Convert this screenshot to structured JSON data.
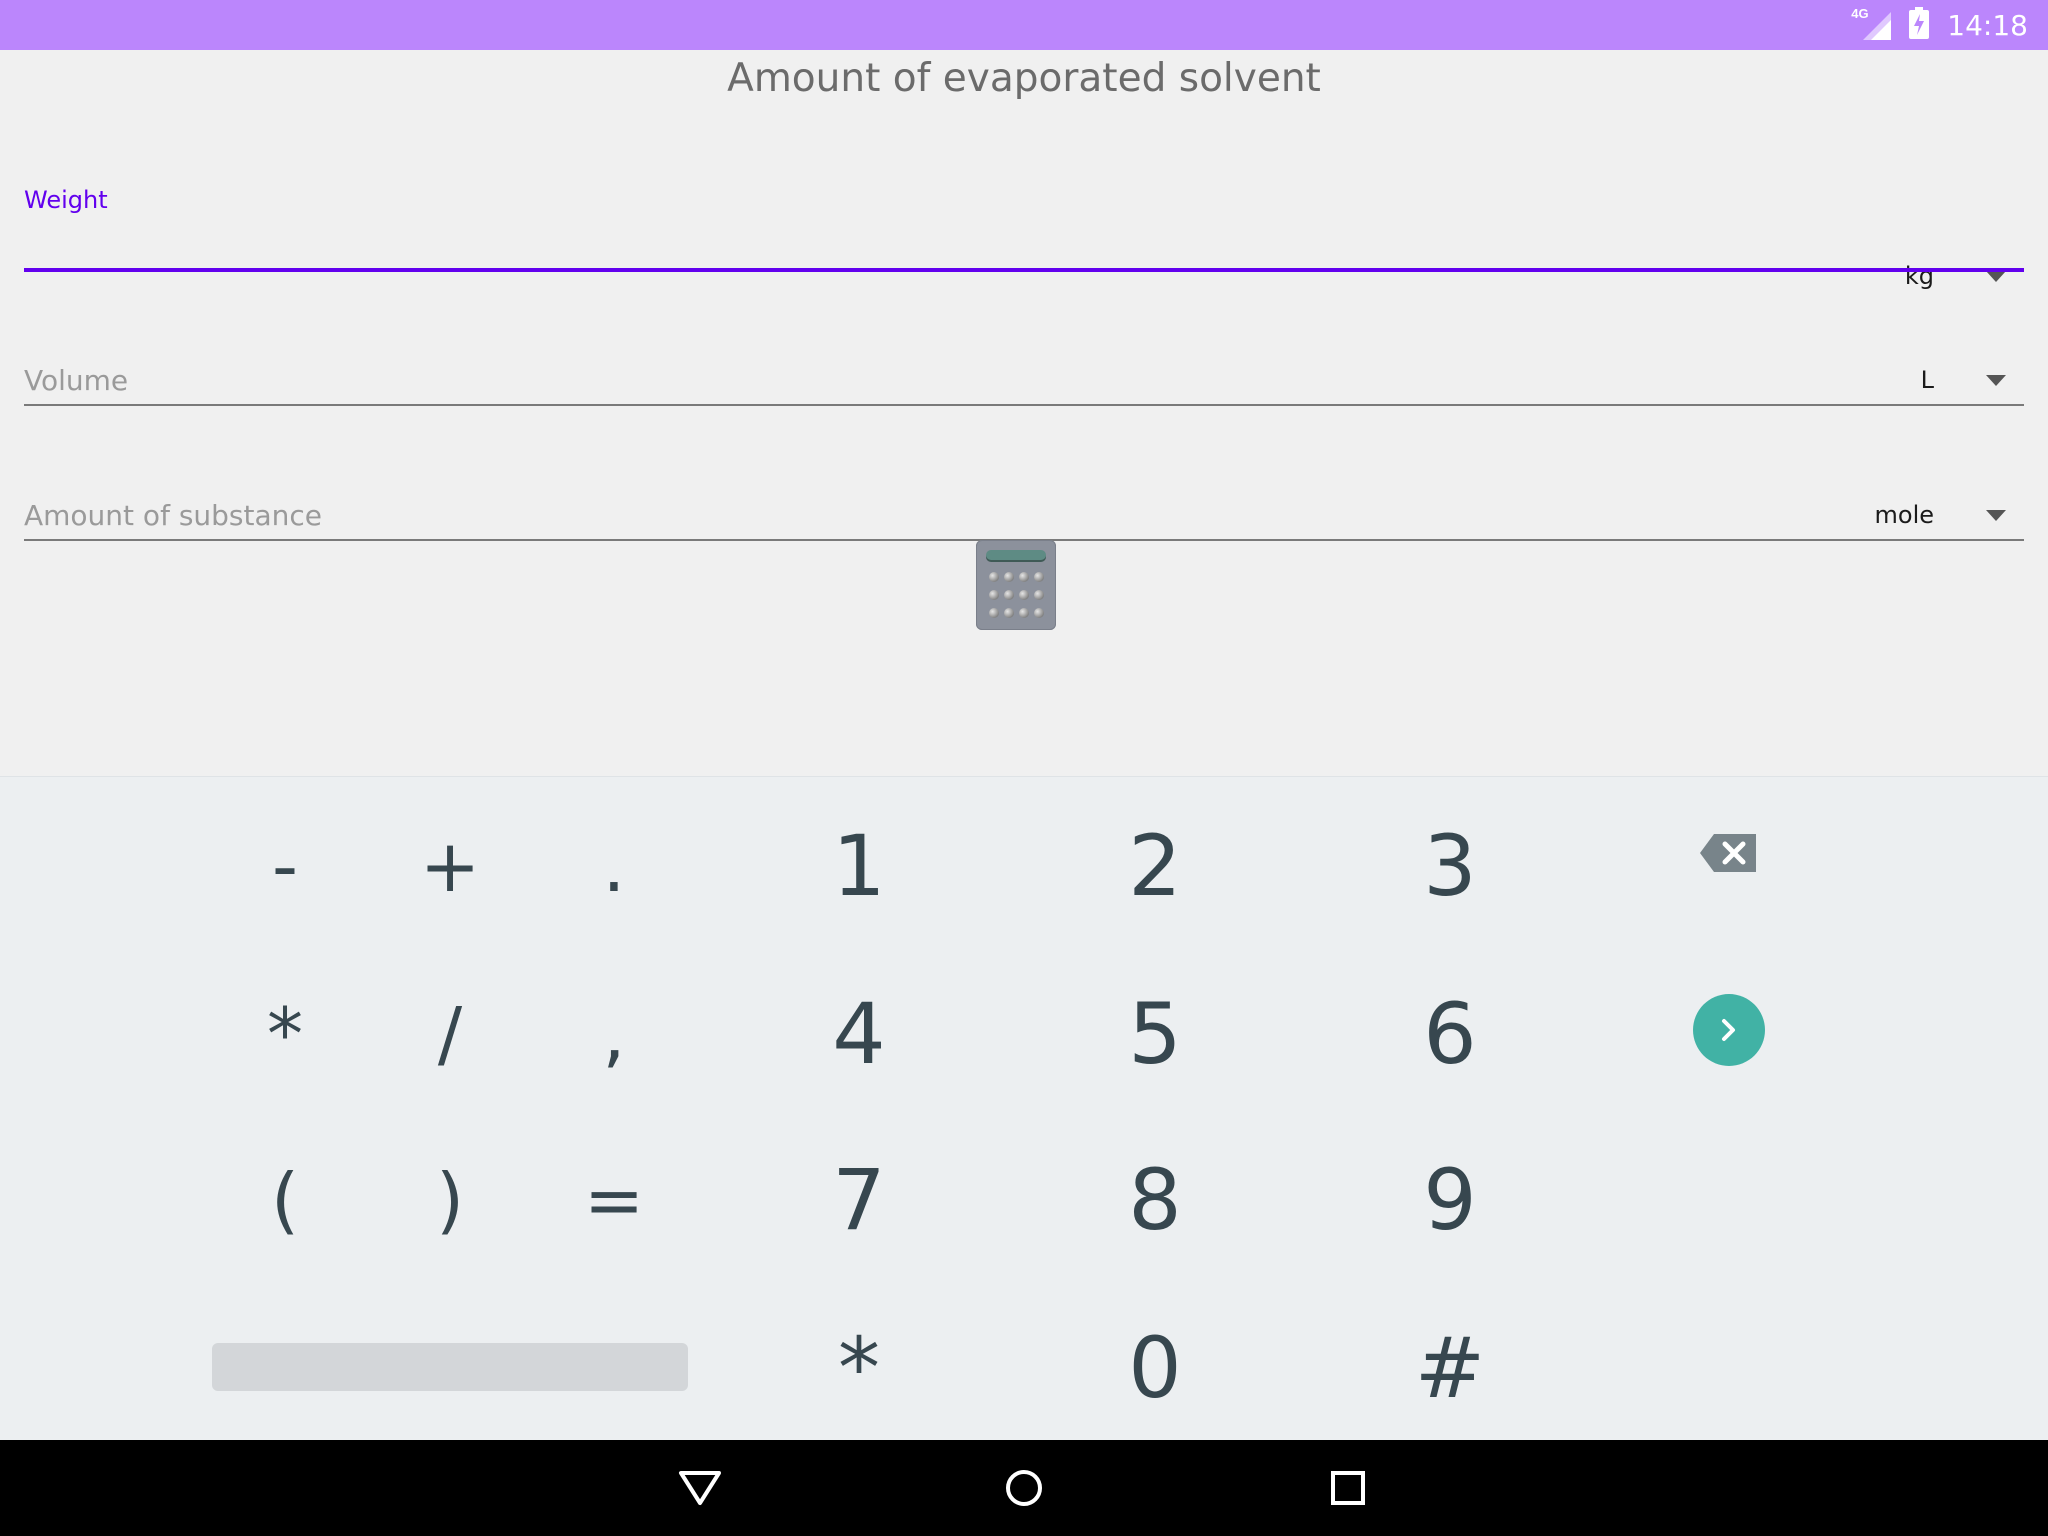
{
  "status_bar": {
    "time": "14:18",
    "network": "4G",
    "background_color": "#bb86fc"
  },
  "app": {
    "title": "Amount of evaporated solvent",
    "fields": [
      {
        "label": "Weight",
        "unit": "kg",
        "focused": true,
        "value": ""
      },
      {
        "label": "Volume",
        "unit": "L",
        "focused": false,
        "value": ""
      },
      {
        "label": "Amount of substance",
        "unit": "mole",
        "focused": false,
        "value": ""
      }
    ],
    "calculate_icon": "calculator-icon",
    "accent_color": "#6200ee"
  },
  "keyboard": {
    "rows": [
      [
        "-",
        "+",
        ".",
        "1",
        "2",
        "3"
      ],
      [
        "*",
        "/",
        ",",
        "4",
        "5",
        "6"
      ],
      [
        "(",
        ")",
        "=",
        "7",
        "8",
        "9"
      ],
      [
        "*",
        "0",
        "#"
      ]
    ],
    "backspace_icon": "backspace-icon",
    "go_icon": "chevron-right-icon",
    "go_color": "#41b2a5"
  },
  "nav_bar": {
    "back_icon": "back-triangle-icon",
    "home_icon": "home-circle-icon",
    "recents_icon": "recents-square-icon"
  }
}
